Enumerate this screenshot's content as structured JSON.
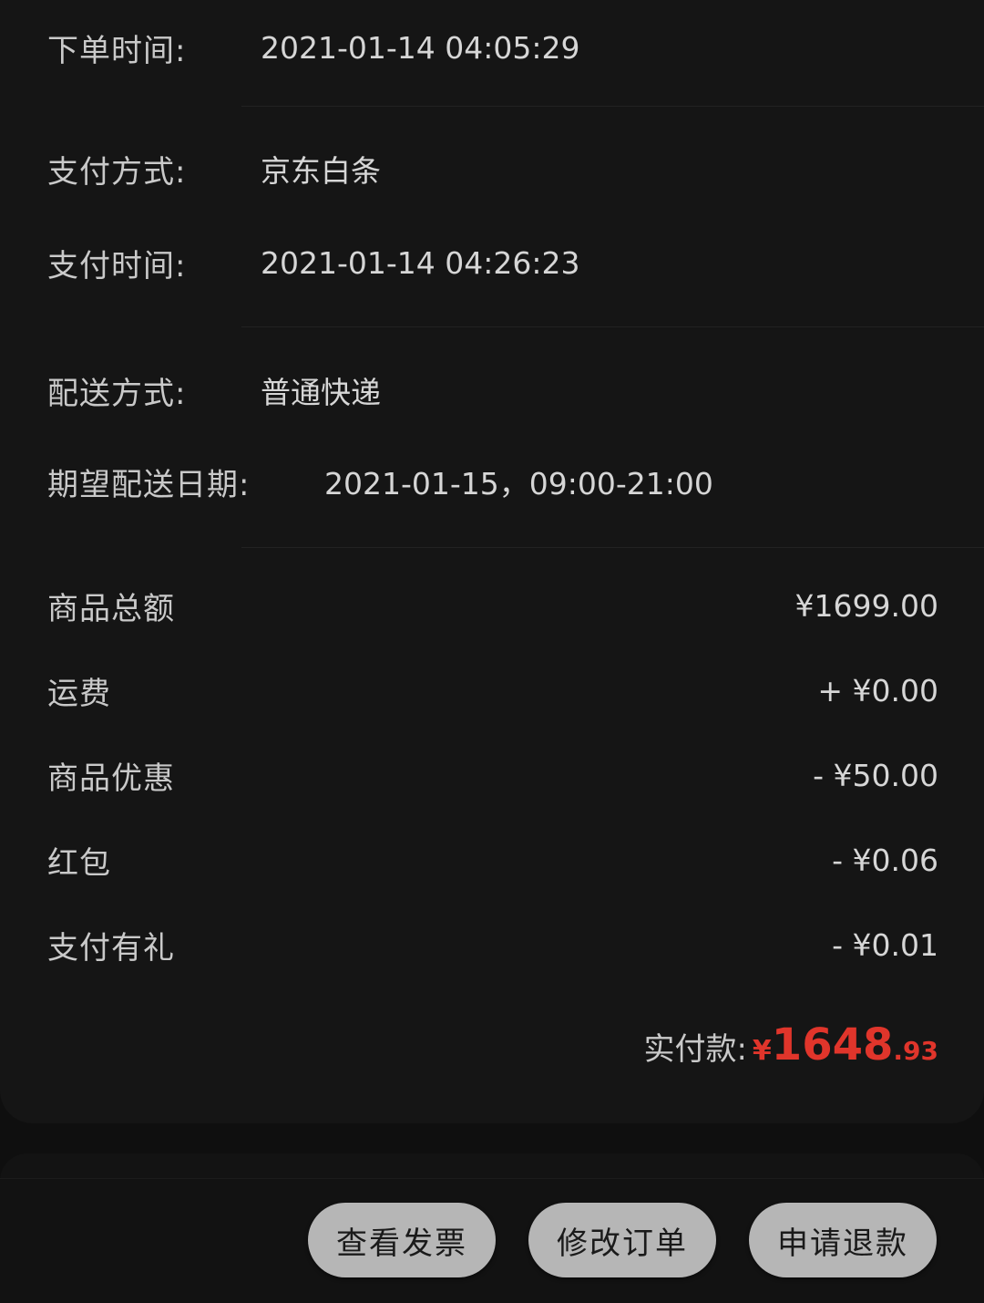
{
  "order_info": {
    "order_time_label": "下单时间:",
    "order_time_value": "2021-01-14 04:05:29",
    "pay_method_label": "支付方式:",
    "pay_method_value": "京东白条",
    "pay_time_label": "支付时间:",
    "pay_time_value": "2021-01-14 04:26:23",
    "delivery_method_label": "配送方式:",
    "delivery_method_value": "普通快递",
    "expected_date_label": "期望配送日期:",
    "expected_date_value": "2021-01-15，09:00-21:00"
  },
  "amounts": [
    {
      "label": "商品总额",
      "value": "¥1699.00"
    },
    {
      "label": "运费",
      "value": "+ ¥0.00"
    },
    {
      "label": "商品优惠",
      "value": "- ¥50.00"
    },
    {
      "label": "红包",
      "value": "- ¥0.06"
    },
    {
      "label": "支付有礼",
      "value": "- ¥0.01"
    }
  ],
  "total": {
    "label": "实付款:",
    "currency": "¥",
    "integer": "1648",
    "decimal": ".93",
    "color": "#e0352b"
  },
  "actions": {
    "view_invoice": "查看发票",
    "modify_order": "修改订单",
    "apply_refund": "申请退款"
  }
}
